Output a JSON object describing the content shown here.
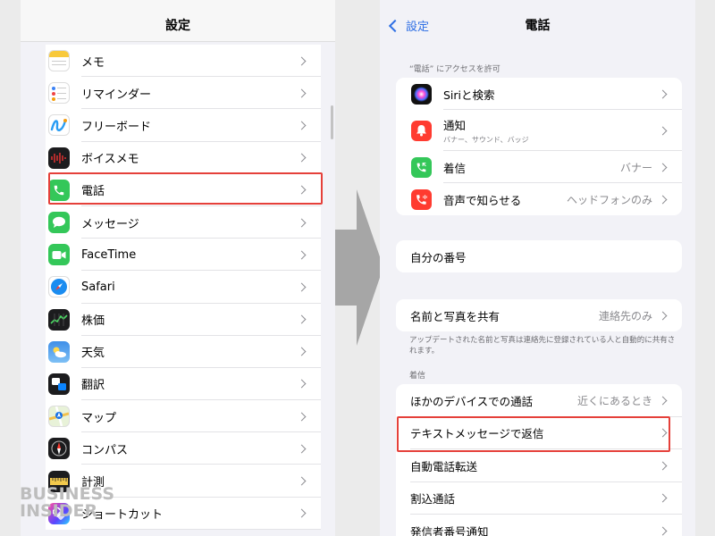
{
  "left_screen": {
    "title": "設定",
    "items": [
      {
        "label": "メモ",
        "icon": "notes-icon"
      },
      {
        "label": "リマインダー",
        "icon": "reminders-icon"
      },
      {
        "label": "フリーボード",
        "icon": "freeform-icon"
      },
      {
        "label": "ボイスメモ",
        "icon": "voice-memos-icon"
      },
      {
        "label": "電話",
        "icon": "phone-icon"
      },
      {
        "label": "メッセージ",
        "icon": "messages-icon"
      },
      {
        "label": "FaceTime",
        "icon": "facetime-icon"
      },
      {
        "label": "Safari",
        "icon": "safari-icon"
      },
      {
        "label": "株価",
        "icon": "stocks-icon"
      },
      {
        "label": "天気",
        "icon": "weather-icon"
      },
      {
        "label": "翻訳",
        "icon": "translate-icon"
      },
      {
        "label": "マップ",
        "icon": "maps-icon"
      },
      {
        "label": "コンパス",
        "icon": "compass-icon"
      },
      {
        "label": "計測",
        "icon": "measure-icon"
      },
      {
        "label": "ショートカット",
        "icon": "shortcuts-icon"
      }
    ],
    "highlighted_item": "電話"
  },
  "right_screen": {
    "back_label": "設定",
    "title": "電話",
    "access_header": "“電話” にアクセスを許可",
    "access_items": [
      {
        "label": "Siriと検索",
        "sub": "",
        "value": "",
        "icon": "siri-icon"
      },
      {
        "label": "通知",
        "sub": "バナー、サウンド、バッジ",
        "value": "",
        "icon": "notifications-icon"
      },
      {
        "label": "着信",
        "sub": "",
        "value": "バナー",
        "icon": "incoming-call-icon"
      },
      {
        "label": "音声で知らせる",
        "sub": "",
        "value": "ヘッドフォンのみ",
        "icon": "announce-calls-icon"
      }
    ],
    "my_number_label": "自分の番号",
    "share_label": "名前と写真を共有",
    "share_value": "連絡先のみ",
    "share_footnote": "アップデートされた名前と写真は連絡先に登録されている人と自動的に共有されます。",
    "calls_header": "着信",
    "calls_items": [
      {
        "label": "ほかのデバイスでの通話",
        "value": "近くにあるとき"
      },
      {
        "label": "テキストメッセージで返信",
        "value": ""
      },
      {
        "label": "自動電話転送",
        "value": ""
      },
      {
        "label": "割込通話",
        "value": ""
      },
      {
        "label": "発信者番号通知",
        "value": ""
      }
    ],
    "highlighted_item": "テキストメッセージで返信"
  },
  "watermark": {
    "line1": "BUSINESS",
    "line2": "INSIDER"
  },
  "colors": {
    "highlight": "#e5403a",
    "accent_blue": "#2f6fe4",
    "arrow": "#a6a6a6"
  }
}
